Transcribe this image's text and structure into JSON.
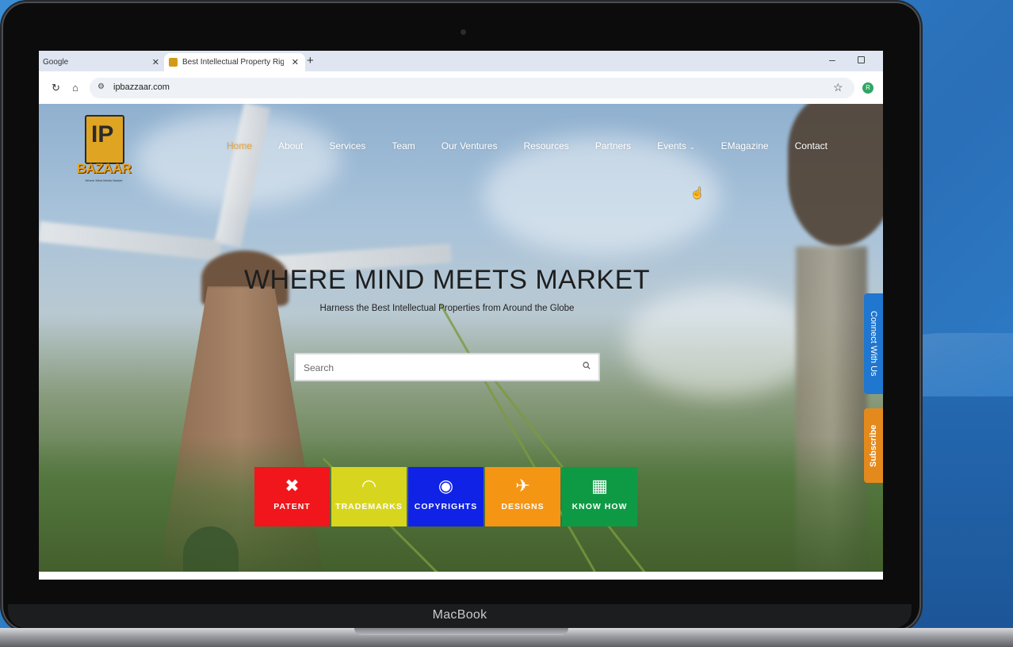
{
  "device": {
    "label": "MacBook"
  },
  "browser": {
    "tabs": [
      {
        "title": "Google",
        "active": false
      },
      {
        "title": "Best Intellectual Property Right",
        "active": true
      }
    ],
    "new_tab_icon": "plus-icon",
    "url": "ipbazzaar.com",
    "profile_initial": "R"
  },
  "site": {
    "logo": {
      "name": "BAZAAR",
      "mark": "IP",
      "tagline": "Where Mind Meets Market"
    },
    "nav": [
      {
        "label": "Home",
        "active": true
      },
      {
        "label": "About"
      },
      {
        "label": "Services"
      },
      {
        "label": "Team"
      },
      {
        "label": "Our Ventures"
      },
      {
        "label": "Resources"
      },
      {
        "label": "Partners"
      },
      {
        "label": "Events",
        "dropdown": true
      },
      {
        "label": "EMagazine"
      },
      {
        "label": "Contact"
      }
    ],
    "headline": "WHERE MIND MEETS MARKET",
    "subheadline": "Harness the Best Intellectual Properties from Around the Globe",
    "search": {
      "placeholder": "Search",
      "value": ""
    },
    "categories": [
      {
        "label": "PATENT",
        "icon": "tools-icon",
        "color": "#f0161b"
      },
      {
        "label": "TRADEMARKS",
        "icon": "wifi-icon",
        "color": "#d8d51f"
      },
      {
        "label": "COPYRIGHTS",
        "icon": "fingerprint-icon",
        "color": "#1022e6"
      },
      {
        "label": "DESIGNS",
        "icon": "plane-icon",
        "color": "#f59514"
      },
      {
        "label": "KNOW HOW",
        "icon": "qr-code-icon",
        "color": "#0e9a45"
      }
    ],
    "side_buttons": {
      "connect": "Connect With Us",
      "subscribe": "Subscribe"
    }
  }
}
